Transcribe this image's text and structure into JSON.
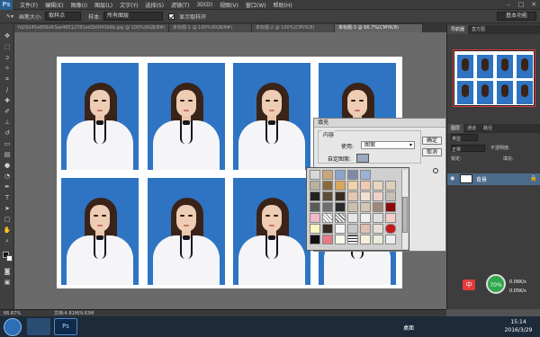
{
  "app": {
    "logo": "Ps"
  },
  "menubar": {
    "items": [
      "文件(F)",
      "编辑(E)",
      "图像(I)",
      "图层(L)",
      "文字(Y)",
      "选择(S)",
      "滤镜(T)",
      "3D(D)",
      "视图(V)",
      "窗口(W)",
      "帮助(H)"
    ]
  },
  "options": {
    "brush_size_label": "画笔大小:",
    "sample_value": "取样点",
    "sample_label": "样本:",
    "sample_select": "所有图层",
    "show_ring_label": "显示取样环",
    "workspace": "基本功能"
  },
  "tabs": [
    "fd29245e856d43ae46512781ed2b0f43b6b.jpg @ 100%(RGB/8#)",
    "未标题-1 @ 100%(RGB/8#)",
    "未标题-2 @ 100%(CMYK/8)",
    "未标题-3 @ 66.7%(CMYK/8)"
  ],
  "panels": {
    "navigator_tabs": [
      "导航器",
      "直方图"
    ],
    "layers_tabs": [
      "图层",
      "通道",
      "路径"
    ],
    "kind": "类型",
    "blend": "正常",
    "opacity": "不透明度:",
    "lock": "锁定:",
    "fill": "填充:",
    "layer_name": "背景"
  },
  "dialog": {
    "title": "填充",
    "content_label": "内容",
    "use_label": "使用:",
    "use_value": "图案",
    "custom_pattern_label": "自定图案:",
    "ok": "确定",
    "cancel": "取消"
  },
  "status": {
    "zoom": "66.67%",
    "doc": "文档:4.81M/9.63M"
  },
  "taskbar": {
    "tray_label": "桌面",
    "time": "15:14",
    "date": "2016/3/29"
  },
  "ime": {
    "label": "中",
    "cpu": "0.06K/s",
    "net": "0.05K/s",
    "percent": "70%"
  }
}
